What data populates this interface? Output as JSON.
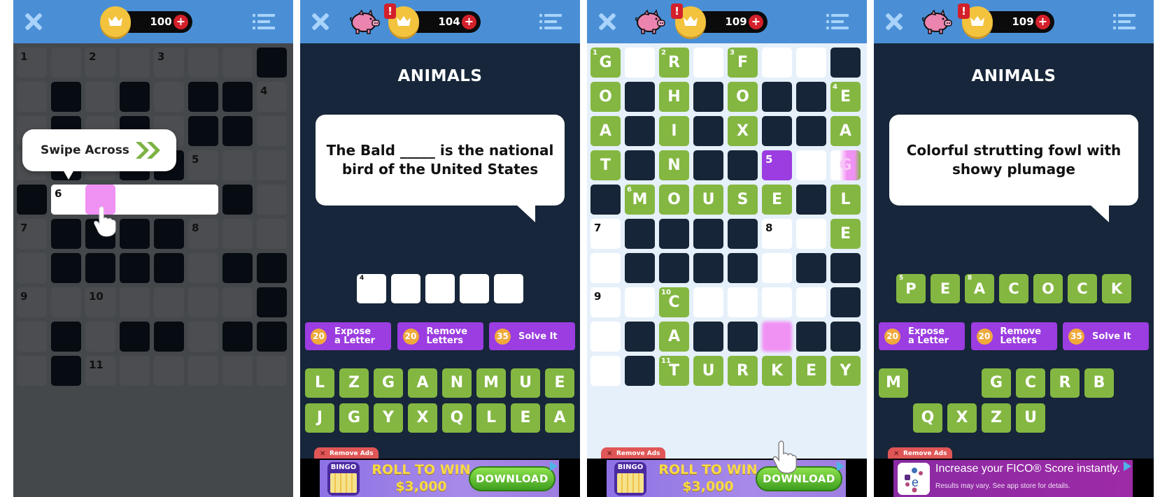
{
  "panels": [
    {
      "id": "tutorial",
      "topbar": {
        "coins": "100",
        "show_pig": false,
        "show_alert": false
      },
      "tooltip": {
        "text": "Swipe Across",
        "icon": "double-chevron-right-icon"
      },
      "grid": {
        "cols": 8,
        "rows": 10,
        "cells": [
          [
            "1",
            "",
            "2",
            "",
            "3",
            "",
            "",
            "#"
          ],
          [
            "",
            "#",
            "",
            "#",
            "",
            "#",
            "#",
            "4"
          ],
          [
            "",
            "#",
            "",
            "#",
            "",
            "#",
            "#",
            ""
          ],
          [
            "",
            "#",
            "",
            "#",
            "#",
            "5",
            "",
            ""
          ],
          [
            "#",
            "6",
            "P",
            "W",
            "W",
            "W",
            "#",
            ""
          ],
          [
            "7",
            "#",
            "#",
            "#",
            "#",
            "8",
            "",
            ""
          ],
          [
            "",
            "#",
            "#",
            "#",
            "#",
            "",
            "#",
            "#"
          ],
          [
            "9",
            "",
            "10",
            "",
            "",
            "",
            "",
            "#"
          ],
          [
            "",
            "#",
            "",
            "#",
            "#",
            "",
            "#",
            "#"
          ],
          [
            "",
            "#",
            "11",
            "",
            "",
            "",
            "",
            ""
          ]
        ],
        "legend": {
          "#": "black",
          "P": "highlighted-pink",
          "W": "selected-white",
          "": "empty"
        }
      }
    },
    {
      "id": "clue-eagle",
      "topbar": {
        "coins": "104",
        "show_pig": true,
        "show_alert": true,
        "alert": "!"
      },
      "category": "ANIMALS",
      "clue": "The Bald _____ is the national bird of the United States",
      "answer": {
        "number": "4",
        "letters": [
          "",
          "",
          "",
          "",
          ""
        ]
      },
      "hints": [
        {
          "cost": "20",
          "label": "Expose a Letter"
        },
        {
          "cost": "20",
          "label": "Remove Letters"
        },
        {
          "cost": "35",
          "label": "Solve It"
        }
      ],
      "letter_tiles": [
        [
          "L",
          "Z",
          "G",
          "A",
          "N",
          "M",
          "U",
          "E"
        ],
        [
          "J",
          "G",
          "Y",
          "X",
          "Q",
          "L",
          "E",
          "A"
        ]
      ],
      "ad": {
        "remove_label": "Remove Ads",
        "type": "bingo",
        "icon_label": "BINGO",
        "headline": "ROLL TO WIN $3,000",
        "cta": "DOWNLOAD"
      }
    },
    {
      "id": "board-progress",
      "topbar": {
        "coins": "109",
        "show_pig": true,
        "show_alert": true,
        "alert": "!"
      },
      "grid": {
        "cols": 8,
        "rows": 10,
        "cells": [
          [
            {
              "t": "g",
              "l": "G",
              "n": "1"
            },
            {
              "t": "e"
            },
            {
              "t": "g",
              "l": "R",
              "n": "2"
            },
            {
              "t": "e"
            },
            {
              "t": "g",
              "l": "F",
              "n": "3"
            },
            {
              "t": "e"
            },
            {
              "t": "e"
            },
            {
              "t": "b"
            }
          ],
          [
            {
              "t": "g",
              "l": "O"
            },
            {
              "t": "b"
            },
            {
              "t": "g",
              "l": "H"
            },
            {
              "t": "b"
            },
            {
              "t": "g",
              "l": "O"
            },
            {
              "t": "b"
            },
            {
              "t": "b"
            },
            {
              "t": "g",
              "l": "E",
              "n": "4"
            }
          ],
          [
            {
              "t": "g",
              "l": "A"
            },
            {
              "t": "b"
            },
            {
              "t": "g",
              "l": "I"
            },
            {
              "t": "b"
            },
            {
              "t": "g",
              "l": "X"
            },
            {
              "t": "b"
            },
            {
              "t": "b"
            },
            {
              "t": "g",
              "l": "A"
            }
          ],
          [
            {
              "t": "g",
              "l": "T"
            },
            {
              "t": "b"
            },
            {
              "t": "g",
              "l": "N"
            },
            {
              "t": "b"
            },
            {
              "t": "b"
            },
            {
              "t": "p",
              "n": "5"
            },
            {
              "t": "e"
            },
            {
              "t": "x",
              "l": "G"
            }
          ],
          [
            {
              "t": "b"
            },
            {
              "t": "g",
              "l": "M",
              "n": "6"
            },
            {
              "t": "g",
              "l": "O"
            },
            {
              "t": "g",
              "l": "U"
            },
            {
              "t": "g",
              "l": "S"
            },
            {
              "t": "g",
              "l": "E"
            },
            {
              "t": "b"
            },
            {
              "t": "g",
              "l": "L"
            }
          ],
          [
            {
              "t": "e",
              "nb": "7"
            },
            {
              "t": "b"
            },
            {
              "t": "b"
            },
            {
              "t": "b"
            },
            {
              "t": "b"
            },
            {
              "t": "e",
              "nb": "8"
            },
            {
              "t": "e"
            },
            {
              "t": "g",
              "l": "E"
            }
          ],
          [
            {
              "t": "e"
            },
            {
              "t": "b"
            },
            {
              "t": "b"
            },
            {
              "t": "b"
            },
            {
              "t": "b"
            },
            {
              "t": "e"
            },
            {
              "t": "b"
            },
            {
              "t": "b"
            }
          ],
          [
            {
              "t": "e",
              "nb": "9"
            },
            {
              "t": "e"
            },
            {
              "t": "g",
              "l": "C",
              "n": "10"
            },
            {
              "t": "e"
            },
            {
              "t": "e"
            },
            {
              "t": "e"
            },
            {
              "t": "e"
            },
            {
              "t": "b"
            }
          ],
          [
            {
              "t": "e"
            },
            {
              "t": "b"
            },
            {
              "t": "g",
              "l": "A"
            },
            {
              "t": "b"
            },
            {
              "t": "b"
            },
            {
              "t": "k"
            },
            {
              "t": "b"
            },
            {
              "t": "b"
            }
          ],
          [
            {
              "t": "e"
            },
            {
              "t": "b"
            },
            {
              "t": "g",
              "l": "T",
              "n": "11"
            },
            {
              "t": "g",
              "l": "U"
            },
            {
              "t": "g",
              "l": "R"
            },
            {
              "t": "g",
              "l": "K"
            },
            {
              "t": "g",
              "l": "E"
            },
            {
              "t": "g",
              "l": "Y"
            }
          ]
        ]
      },
      "ad": {
        "remove_label": "Remove Ads",
        "type": "bingo",
        "icon_label": "BINGO",
        "headline": "ROLL TO WIN $3,000",
        "cta": "DOWNLOAD"
      }
    },
    {
      "id": "clue-peacock",
      "topbar": {
        "coins": "109",
        "show_pig": true,
        "show_alert": true,
        "alert": "!"
      },
      "category": "ANIMALS",
      "clue": "Colorful strutting fowl with showy plumage",
      "answer": {
        "letters": [
          "P",
          "E",
          "A",
          "C",
          "O",
          "C",
          "K"
        ],
        "numbers": {
          "0": "5",
          "2": "8"
        }
      },
      "hints": [
        {
          "cost": "20",
          "label": "Expose a Letter"
        },
        {
          "cost": "20",
          "label": "Remove Letters"
        },
        {
          "cost": "35",
          "label": "Solve It"
        }
      ],
      "letter_tiles": [
        [
          "M",
          "",
          "",
          "G",
          "C",
          "R",
          "B",
          ""
        ],
        [
          "",
          "Q",
          "X",
          "Z",
          "U",
          "",
          "",
          ""
        ]
      ],
      "ad": {
        "remove_label": "Remove Ads",
        "type": "fico",
        "headline": "Increase your FICO® Score instantly.",
        "subline": "Results may vary. See app store for details."
      }
    }
  ],
  "colors": {
    "topbar": "#4a8fd6",
    "green_tile": "#84b742",
    "purple": "#9b3de0",
    "pink": "#f091f4",
    "dark_navy": "#17263a",
    "coin_gold": "#f3c33e",
    "red": "#d3202a"
  }
}
